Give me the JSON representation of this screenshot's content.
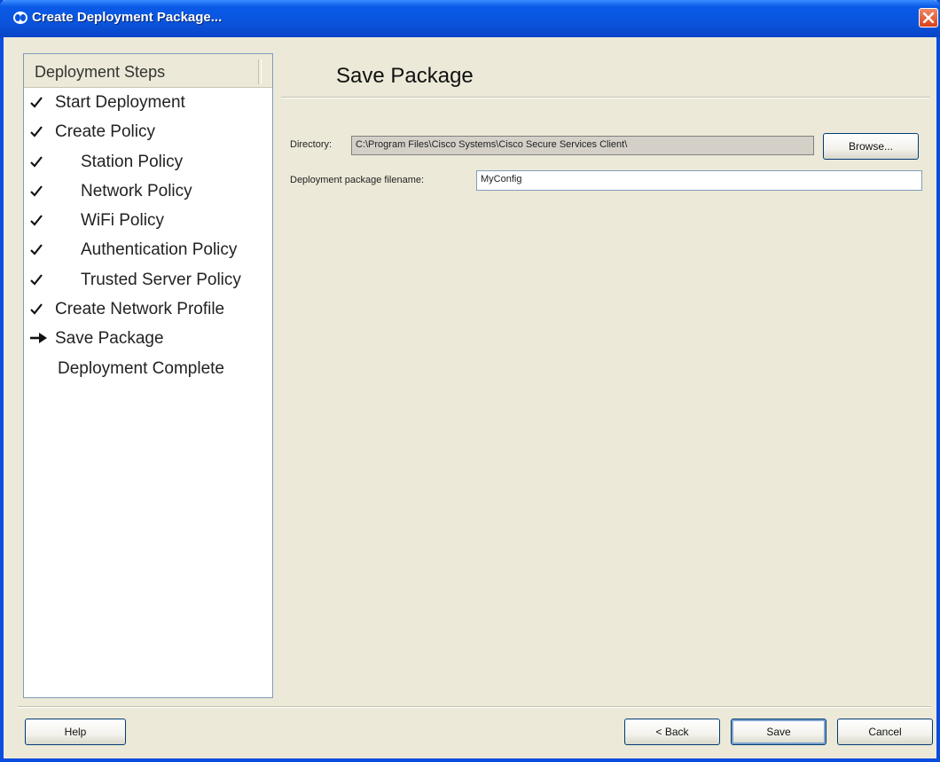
{
  "window": {
    "title": "Create Deployment Package...",
    "colors": {
      "titlebar": "#0a54dc",
      "close": "#d9411b",
      "background": "#ece9d8"
    }
  },
  "sidebar": {
    "header": "Deployment Steps",
    "steps": [
      {
        "label": "Start Deployment",
        "status": "done",
        "level": 1,
        "icon": "check-icon"
      },
      {
        "label": "Create Policy",
        "status": "done",
        "level": 1,
        "icon": "check-icon"
      },
      {
        "label": "Station Policy",
        "status": "done",
        "level": 2,
        "icon": "check-icon"
      },
      {
        "label": "Network Policy",
        "status": "done",
        "level": 2,
        "icon": "check-icon"
      },
      {
        "label": "WiFi Policy",
        "status": "done",
        "level": 2,
        "icon": "check-icon"
      },
      {
        "label": "Authentication Policy",
        "status": "done",
        "level": 2,
        "icon": "check-icon"
      },
      {
        "label": "Trusted Server Policy",
        "status": "done",
        "level": 2,
        "icon": "check-icon"
      },
      {
        "label": "Create Network Profile",
        "status": "done",
        "level": 1,
        "icon": "check-icon"
      },
      {
        "label": "Save Package",
        "status": "current",
        "level": 1,
        "icon": "arrow-right-icon"
      },
      {
        "label": "Deployment Complete",
        "status": "pending",
        "level": 1,
        "icon": ""
      }
    ]
  },
  "main": {
    "title": "Save Package",
    "directory_label": "Directory:",
    "directory_value": "C:\\Program Files\\Cisco Systems\\Cisco Secure Services Client\\",
    "browse_label": "Browse...",
    "filename_label": "Deployment package filename:",
    "filename_value": "MyConfig"
  },
  "footer": {
    "help_label": "Help",
    "back_label": "< Back",
    "save_label": "Save",
    "cancel_label": "Cancel"
  }
}
